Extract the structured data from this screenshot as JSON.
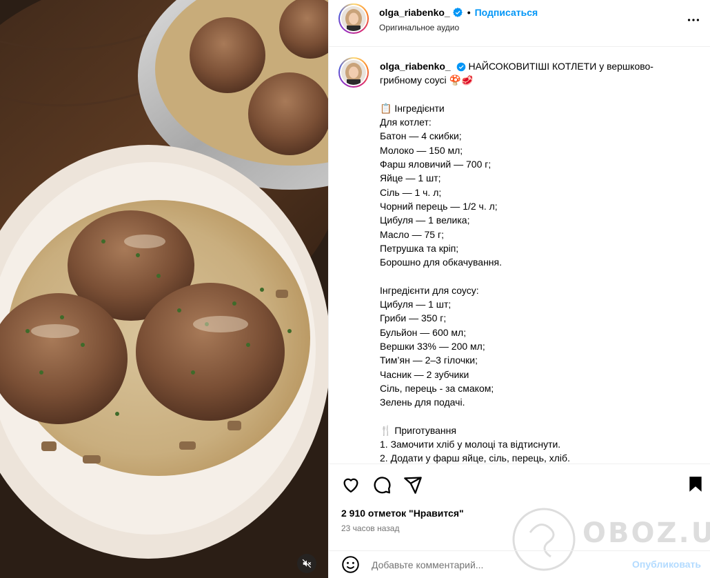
{
  "post": {
    "username": "olga_riabenko_",
    "follow_label": "Подписаться",
    "separator": "•",
    "audio_label": "Оригинальное аудио"
  },
  "caption": {
    "username": "olga_riabenko_",
    "headline": "НАЙСОКОВИТІШІ КОТЛЕТИ у вершково-грибному соусі 🍄🥩",
    "lines": [
      "",
      "📋 Інгредієнти",
      "Для котлет:",
      "Батон — 4 скибки;",
      "Молоко — 150 мл;",
      "Фарш яловичий — 700 г;",
      "Яйце — 1 шт;",
      "Сіль — 1 ч. л;",
      "Чорний перець — 1/2 ч. л;",
      "Цибуля — 1 велика;",
      "Масло — 75 г;",
      "Петрушка та кріп;",
      "Борошно для обкачування.",
      "",
      "Інгредієнти для соусу:",
      "Цибуля — 1 шт;",
      "Гриби — 350 г;",
      "Бульйон — 600 мл;",
      "Вершки 33% — 200 мл;",
      "Тим’ян — 2–3 гілочки;",
      "Часник — 2 зубчики",
      "Сіль, перець - за смаком;",
      "Зелень для подачі.",
      "",
      "🍴 Приготування",
      "1. Замочити хліб у молоці та відтиснути.",
      "2. Додати у фарш яйце, сіль, перець, хліб."
    ]
  },
  "engagement": {
    "likes": "2 910 отметок \"Нравится\"",
    "time_ago": "23 часов назад"
  },
  "comment": {
    "placeholder": "Добавьте комментарий...",
    "publish_label": "Опубликовать"
  },
  "watermark": {
    "text": "OBOZ.UA"
  },
  "icons": {
    "header_more": "more-horizontal-icon",
    "like": "heart-icon",
    "comment": "comment-icon",
    "share": "share-icon",
    "save": "bookmark-icon",
    "emoji": "emoji-icon",
    "mute": "muted-audio-icon",
    "verified": "verified-badge-icon"
  },
  "colors": {
    "link_blue": "#0095f6",
    "publish_disabled": "#b3dbff",
    "verified_blue": "#0095f6",
    "secondary_text": "#737373"
  }
}
